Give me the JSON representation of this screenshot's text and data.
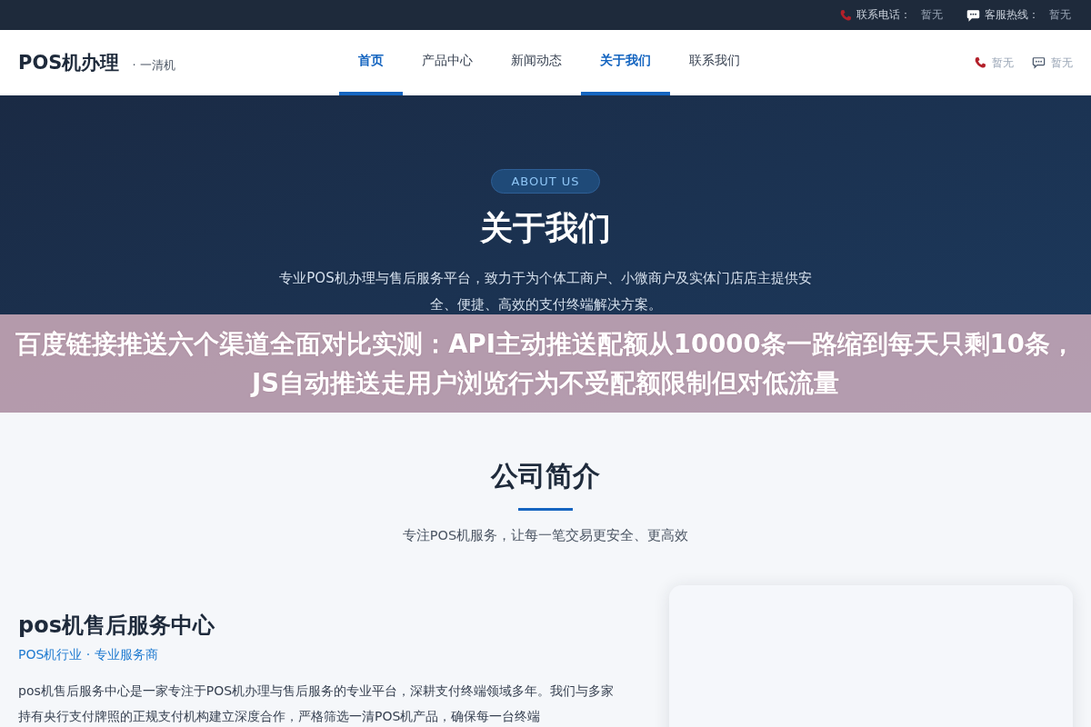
{
  "top_bar": {
    "items": [
      {
        "kind": "phone",
        "label": "联系电话：",
        "value": "暂无"
      },
      {
        "kind": "chat",
        "label": "客服热线：",
        "value": "暂无"
      }
    ]
  },
  "header": {
    "logo": "POS机办理",
    "tagline": "· 一清机",
    "nav": [
      {
        "label": "首页",
        "selected": true
      },
      {
        "label": "产品中心",
        "selected": false
      },
      {
        "label": "新闻动态",
        "selected": false
      },
      {
        "label": "关于我们",
        "selected": true
      },
      {
        "label": "联系我们",
        "selected": false
      }
    ],
    "contacts": [
      {
        "kind": "phone",
        "value": "暂无"
      },
      {
        "kind": "chat",
        "value": "暂无"
      }
    ]
  },
  "hero": {
    "badge": "ABOUT US",
    "title": "关于我们",
    "subtitle": "专业POS机办理与售后服务平台，致力于为个体工商户、小微商户及实体门店店主提供安全、便捷、高效的支付终端解决方案。"
  },
  "banner": {
    "text": "百度链接推送六个渠道全面对比实测：API主动推送配额从10000条一路缩到每天只剩10条，JS自动推送走用户浏览行为不受配额限制但对低流量"
  },
  "intro": {
    "title": "公司简介",
    "subtitle": "专注POS机服务，让每一笔交易更安全、更高效"
  },
  "company": {
    "name": "pos机售后服务中心",
    "tag": "POS机行业 · 专业服务商",
    "description": "pos机售后服务中心是一家专注于POS机办理与售后服务的专业平台，深耕支付终端领域多年。我们与多家持有央行支付牌照的正规支付机构建立深度合作，严格筛选一清POS机产品，确保每一台终端"
  }
}
